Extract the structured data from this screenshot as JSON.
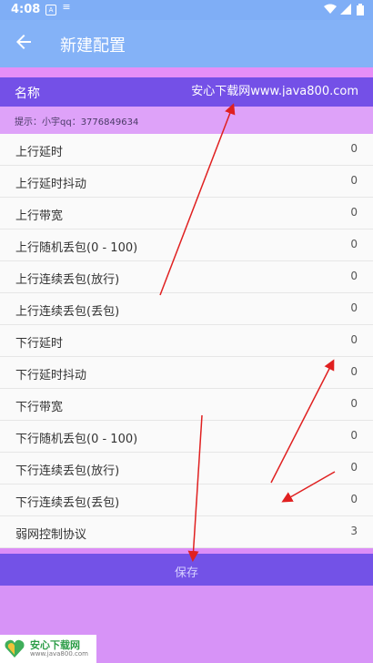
{
  "status_bar": {
    "time": "4:08",
    "notif_icons": [
      "A",
      "≡"
    ]
  },
  "appbar": {
    "title": "新建配置"
  },
  "name_field": {
    "label": "名称",
    "value": "安心下载网www.java800.com"
  },
  "hint": "提示：小宇qq：3776849634",
  "rows": [
    {
      "label": "上行延时",
      "value": "0"
    },
    {
      "label": "上行延时抖动",
      "value": "0"
    },
    {
      "label": "上行带宽",
      "value": "0"
    },
    {
      "label": "上行随机丢包(0 - 100)",
      "value": "0"
    },
    {
      "label": "上行连续丢包(放行)",
      "value": "0"
    },
    {
      "label": "上行连续丢包(丢包)",
      "value": "0"
    },
    {
      "label": "下行延时",
      "value": "0"
    },
    {
      "label": "下行延时抖动",
      "value": "0"
    },
    {
      "label": "下行带宽",
      "value": "0"
    },
    {
      "label": "下行随机丢包(0 - 100)",
      "value": "0"
    },
    {
      "label": "下行连续丢包(放行)",
      "value": "0"
    },
    {
      "label": "下行连续丢包(丢包)",
      "value": "0"
    },
    {
      "label": "弱网控制协议",
      "value": "3"
    }
  ],
  "save_label": "保存",
  "watermark": {
    "brand": "安心下载网",
    "url": "www.java800.com"
  },
  "colors": {
    "appbar": "#84b2f7",
    "name_row": "#7450e7",
    "save_bar": "#7352e7",
    "annotation_arrow": "#e02020"
  }
}
